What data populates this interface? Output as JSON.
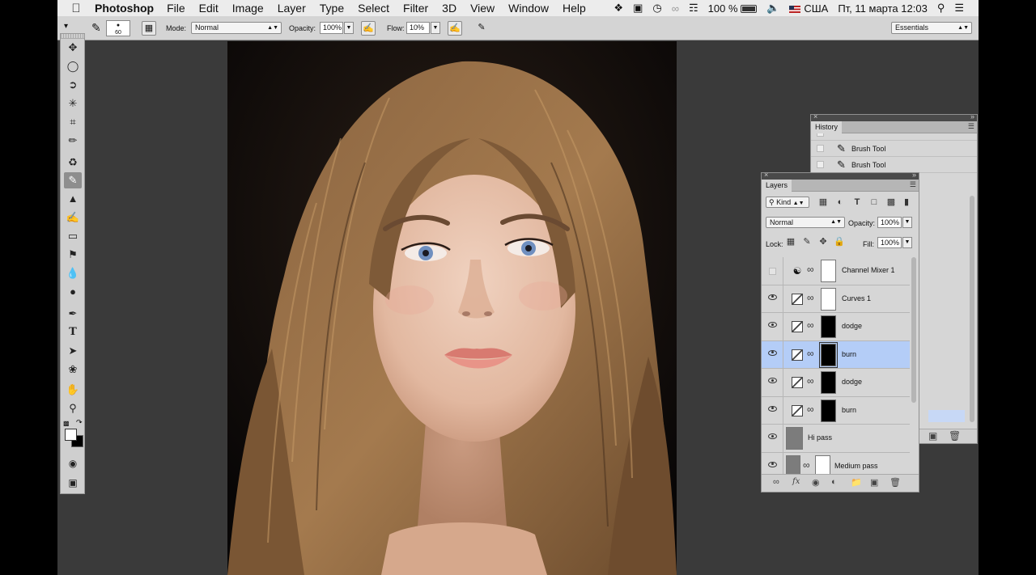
{
  "menubar": {
    "app_name": "Photoshop",
    "menus": [
      "File",
      "Edit",
      "Image",
      "Layer",
      "Type",
      "Select",
      "Filter",
      "3D",
      "View",
      "Window",
      "Help"
    ],
    "battery": "100 %",
    "input_source": "США",
    "datetime": "Пт, 11 марта  12:03"
  },
  "options": {
    "brush_size": "60",
    "mode_label": "Mode:",
    "mode_value": "Normal",
    "opacity_label": "Opacity:",
    "opacity_value": "100%",
    "flow_label": "Flow:",
    "flow_value": "10%",
    "workspace": "Essentials"
  },
  "tools": [
    "move-tool",
    "elliptical-marquee-tool",
    "lasso-tool",
    "quick-selection-tool",
    "crop-tool",
    "eyedropper-tool",
    "spot-healing-tool",
    "brush-tool",
    "clone-stamp-tool",
    "history-brush-tool",
    "eraser-tool",
    "paint-bucket-tool",
    "blur-tool",
    "dodge-tool",
    "pen-tool",
    "type-tool",
    "path-selection-tool",
    "custom-shape-tool",
    "hand-tool",
    "zoom-tool"
  ],
  "history": {
    "title": "History",
    "items": [
      "Brush Tool",
      "Brush Tool"
    ]
  },
  "layers": {
    "title": "Layers",
    "filter_kind": "Kind",
    "blend_mode": "Normal",
    "opacity_label": "Opacity:",
    "opacity_value": "100%",
    "lock_label": "Lock:",
    "fill_label": "Fill:",
    "fill_value": "100%",
    "items": [
      {
        "name": "Channel Mixer 1",
        "visible": false
      },
      {
        "name": "Curves 1",
        "visible": true
      },
      {
        "name": "dodge",
        "visible": true
      },
      {
        "name": "burn",
        "visible": true,
        "selected": true
      },
      {
        "name": "dodge",
        "visible": true
      },
      {
        "name": "burn",
        "visible": true
      },
      {
        "name": "Hi pass",
        "visible": true
      },
      {
        "name": "Medium pass",
        "visible": true
      }
    ]
  },
  "colors": {
    "selection": "#b4cdf7",
    "panel_bg": "#d6d6d6",
    "workspace_bg": "#3a3a3a"
  }
}
